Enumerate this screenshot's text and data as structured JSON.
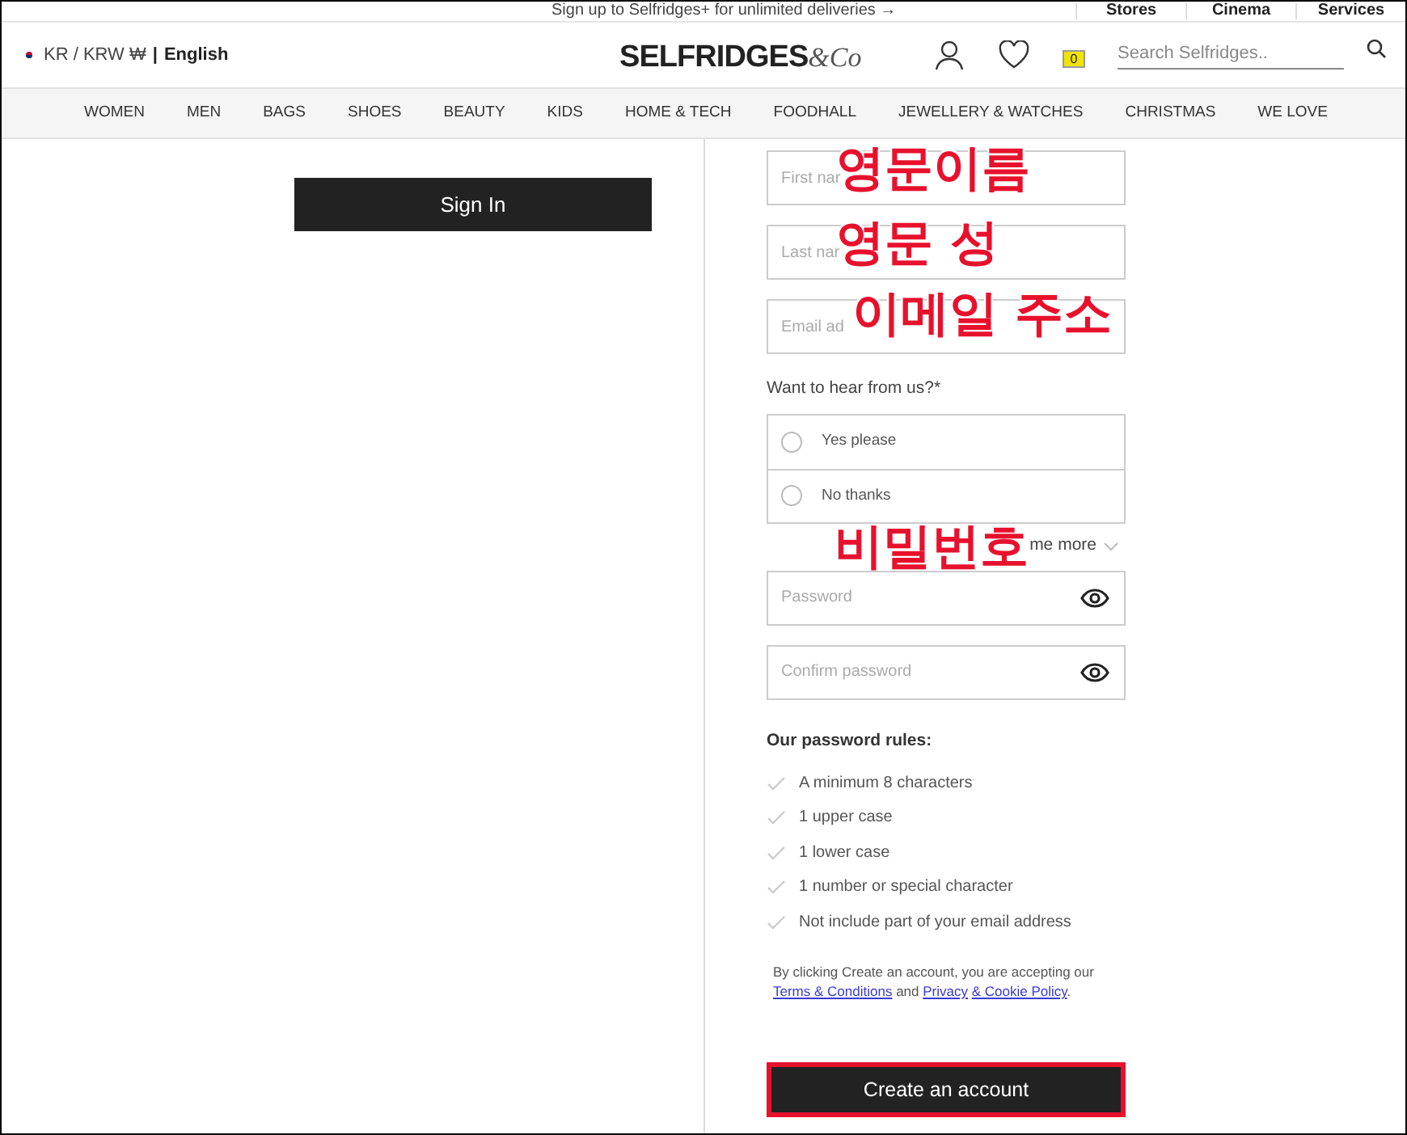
{
  "promo_bar": {
    "text": "Sign up to Selfridges+ for unlimited deliveries →",
    "links": [
      "Stores",
      "Cinema",
      "Services"
    ]
  },
  "header": {
    "locale": "KR / KRW ₩",
    "separator": "|",
    "language": "English",
    "logo": "SELFRIDGES",
    "logo_suffix": "&Co",
    "bag_count": "0",
    "search": {
      "placeholder": "Search Selfridges.."
    }
  },
  "nav": [
    "WOMEN",
    "MEN",
    "BAGS",
    "SHOES",
    "BEAUTY",
    "KIDS",
    "HOME & TECH",
    "FOODHALL",
    "JEWELLERY & WATCHES",
    "CHRISTMAS",
    "WE LOVE"
  ],
  "sign_in": {
    "label": "Sign In"
  },
  "fields": [
    {
      "placeholder": "First nar",
      "annotation": "영문이름"
    },
    {
      "placeholder": "Last nar",
      "annotation": "영문 성"
    },
    {
      "placeholder": "Email ad",
      "annotation": "이메일 주소"
    }
  ],
  "contact": {
    "question": "Want to hear from us?*",
    "options": [
      {
        "label": "Yes please",
        "selected": false
      },
      {
        "label": "No thanks",
        "selected": false
      }
    ],
    "more": "me more",
    "more_annotation": "비밀번호"
  },
  "password_fields": [
    {
      "placeholder": "Password"
    },
    {
      "placeholder": "Confirm password"
    }
  ],
  "rules": {
    "title": "Our password rules:",
    "items": [
      {
        "text": "A minimum 8 characters",
        "met": false
      },
      {
        "text": "1 upper case",
        "met": false
      },
      {
        "text": "1 lower case",
        "met": false
      },
      {
        "text": "1 number or special character",
        "met": false
      },
      {
        "text": "Not include part of your email address",
        "met": false
      }
    ]
  },
  "legal": {
    "before": "By clicking Create an account, you are accepting our",
    "terms": "Terms & Conditions",
    "and": "and",
    "privacy_1": "Privacy",
    "privacy_2": "& Cookie Policy",
    "after": "."
  },
  "create_button": {
    "label": "Create an account",
    "highlighted": true
  }
}
